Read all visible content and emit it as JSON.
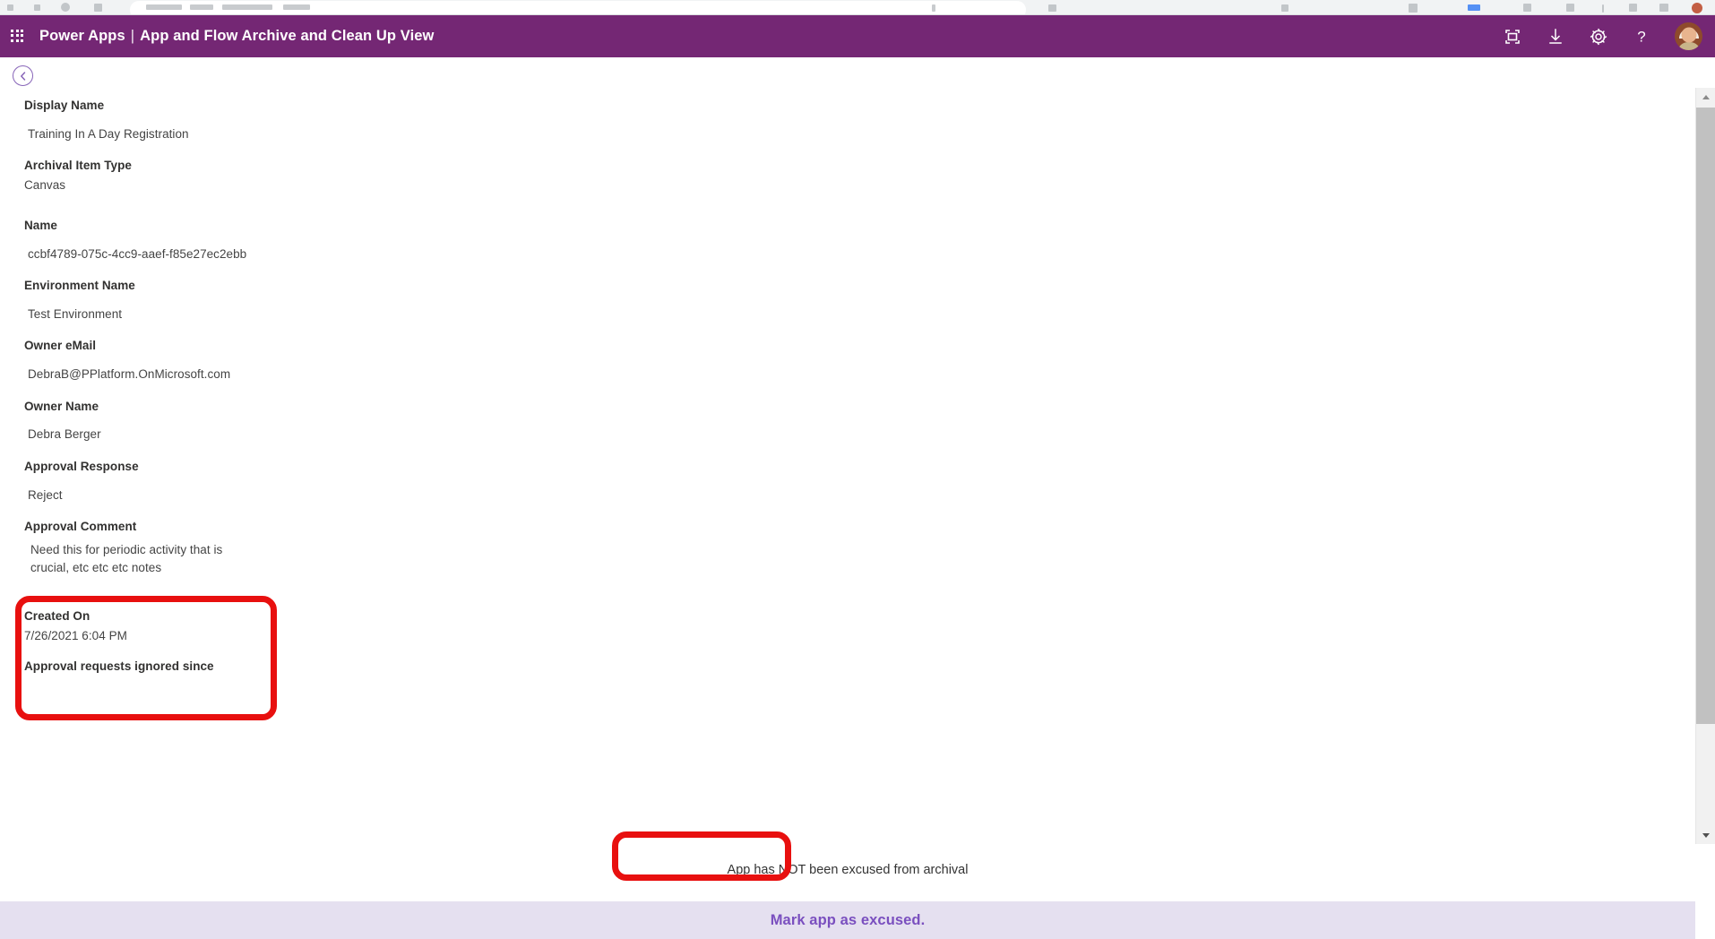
{
  "browser_chrome": {
    "visible": true,
    "note": "cropped browser toolbar strip at very top"
  },
  "header": {
    "waffle_icon": "app-launcher-grid-icon",
    "product": "Power Apps",
    "divider": "|",
    "title": "App and Flow Archive and Clean Up View",
    "brand_color": "#742774",
    "actions": [
      {
        "name": "fullscreen-icon",
        "label": "Full screen"
      },
      {
        "name": "download-icon",
        "label": "Download"
      },
      {
        "name": "gear-icon",
        "label": "Settings"
      },
      {
        "name": "help-icon",
        "label": "?"
      }
    ],
    "avatar_label": "Account manager"
  },
  "nav": {
    "back_label": "Back"
  },
  "form": {
    "fields": [
      {
        "label": "Display Name",
        "value": "Training In A Day Registration"
      },
      {
        "label": "Archival Item Type",
        "value": "Canvas"
      },
      {
        "label": "Name",
        "value": "ccbf4789-075c-4cc9-aaef-f85e27ec2ebb"
      },
      {
        "label": "Environment Name",
        "value": "Test Environment"
      },
      {
        "label": "Owner eMail",
        "value": "DebraB@PPlatform.OnMicrosoft.com"
      },
      {
        "label": "Owner Name",
        "value": "Debra Berger"
      },
      {
        "label": "Approval Response",
        "value": "Reject"
      },
      {
        "label": "Approval Comment",
        "value": "Need this for periodic activity that is crucial, etc etc etc notes"
      },
      {
        "label": "Created On",
        "value": "7/26/2021 6:04 PM"
      },
      {
        "label": "Approval requests ignored since",
        "value": ""
      }
    ]
  },
  "footer": {
    "status": "App has NOT been excused from archival",
    "action_label": "Mark app as excused.",
    "bar_color": "#e5e0f0",
    "action_color": "#7a4fbf"
  },
  "annotations": {
    "color": "#e8100f",
    "boxes": [
      {
        "name": "approval-comment-highlight"
      },
      {
        "name": "mark-excused-button-highlight"
      }
    ]
  },
  "scrollbar": {
    "up_label": "Scroll up",
    "down_label": "Scroll down",
    "thumb_label": "Vertical scroll thumb"
  }
}
